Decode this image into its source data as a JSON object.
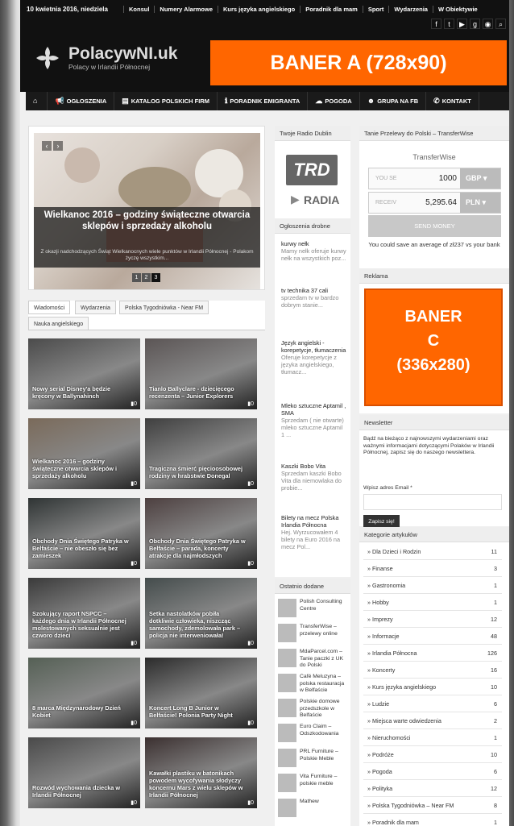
{
  "top": {
    "date": "10 kwietnia 2016, niedziela",
    "links": [
      "Konsul",
      "Numery Alarmowe",
      "Kurs języka angielskiego",
      "Poradnik dla mam",
      "Sport",
      "Wydarzenia",
      "W Obiektywie"
    ],
    "social": [
      "f",
      "t",
      "yt",
      "g+",
      "rss",
      "search"
    ]
  },
  "header": {
    "logo_title": "PolacywNI.uk",
    "logo_sub": "Polacy w Irlandii Północnej",
    "banner_a": "BANER A (728x90)"
  },
  "nav": {
    "items": [
      {
        "icon": "home",
        "label": ""
      },
      {
        "icon": "megaphone",
        "label": "OGŁOSZENIA"
      },
      {
        "icon": "book",
        "label": "KATALOG POLSKICH FIRM"
      },
      {
        "icon": "info",
        "label": "PORADNIK EMIGRANTA"
      },
      {
        "icon": "cloud",
        "label": "POGODA"
      },
      {
        "icon": "group",
        "label": "GRUPA NA FB"
      },
      {
        "icon": "phone",
        "label": "KONTAKT"
      }
    ]
  },
  "slider": {
    "title": "Wielkanoc 2016 – godziny świąteczne otwarcia sklepów i sprzedaży alkoholu",
    "desc": "Z okazji nadchodzących Świąt Wielkanocnych wiele punktów w Irlandii Północnej - Polakom życzę wszystkim...",
    "pages": [
      "1",
      "2",
      "3"
    ],
    "active": "3"
  },
  "tabs": [
    "Wiadomości",
    "Wydarzenia",
    "Polska Tygodniówka - Near FM",
    "Nauka angielskiego"
  ],
  "cards": [
    {
      "title": "Nowy serial Disney'a będzie kręcony w Ballynahinch",
      "count": "0"
    },
    {
      "title": "Tianlo Ballyclare - dziecięcego recenzenta – Junior Explorers",
      "count": "0"
    },
    {
      "title": "Wielkanoc 2016 – godziny świąteczne otwarcia sklepów i sprzedaży alkoholu",
      "count": "0"
    },
    {
      "title": "Tragiczna śmierć pięcioosobowej rodziny w hrabstwie Donegal",
      "count": "0"
    },
    {
      "title": "Obchody Dnia Świętego Patryka w Belfaście – nie obeszło się bez zamieszek",
      "count": "0"
    },
    {
      "title": "Obchody Dnia Świętego Patryka w Belfaście – parada, koncerty atrakcje dla najmłodszych",
      "count": "0"
    },
    {
      "title": "Szokujący raport NSPCC – każdego dnia w Irlandii Północnej molestowanych seksualnie jest czworo dzieci",
      "count": "0"
    },
    {
      "title": "Setka nastolatków pobiła dotkliwie człowieka, niszcząc samochody, zdemolowała park – policja nie interweniowała!",
      "count": "0"
    },
    {
      "title": "8 marca Międzynarodowy Dzień Kobiet",
      "count": "0"
    },
    {
      "title": "Koncert Long B Junior w Belfaście! Polonia Party Night",
      "count": "0"
    },
    {
      "title": "Rozwód wychowania dziecka w Irlandii Północnej",
      "count": "0"
    },
    {
      "title": "Kawałki plastiku w batonikach powodem wycofywania słodyczy koncernu Mars z wielu sklepów w Irlandii Północnej",
      "count": "0"
    }
  ],
  "radio": {
    "header": "Twoje Radio Dublin",
    "logo": "TRD",
    "caption": "RADIA"
  },
  "ads": {
    "header": "Ogłoszenia drobne",
    "items": [
      {
        "t": "kurwy nełk",
        "d": "Mamy nełk oferuje kurwy nełk na wszystkich poz..."
      },
      {
        "t": "tv technika 37 cali",
        "d": "sprzedam tv w bardzo dobrym stanie..."
      },
      {
        "t": "Język angielski - korepetycje, tłumaczenia",
        "d": "Oferuje korepetycje z języka angielskiego, tłumacz..."
      },
      {
        "t": "Mleko sztuczne Aptamil , SMA",
        "d": "Sprzedam ( nie otwarte) mleko sztuczne Aptamil 1 ..."
      },
      {
        "t": "Kaszki Bobo Vita",
        "d": "Sprzedam kaszki Bobo Vita dla niemowlaka do probie..."
      },
      {
        "t": "Bilety na mecz Polska Irlandia Północna",
        "d": "Hej. Wyrzucowałem 4 bilety na Euro 2016 na mecz Pol..."
      }
    ]
  },
  "latest": {
    "header": "Ostatnio dodane",
    "items": [
      "Polish Consulting Centre",
      "TransferWise – przelewy online",
      "MdaParcel.com – Tanie paczki z UK do Polski",
      "Café Meluzyna – polska restauracja w Belfaście",
      "Polskie domowe przedszkole w Belfaście",
      "Euro Claim – Odszkodowania",
      "PRL Furniture – Polskie Meble",
      "Vita Furniture – polskie meble",
      "Mathew"
    ]
  },
  "transferwise": {
    "header": "Tanie Przelewy do Polski – TransferWise",
    "logo": "TransferWise",
    "you_send_label": "YOU SE",
    "you_send_value": "1000",
    "you_send_cur": "GBP",
    "receive_label": "RECEIV",
    "receive_value": "5,295.64",
    "receive_cur": "PLN",
    "button": "SEND MONEY",
    "note": "You could save an average of zł237 vs your bank"
  },
  "reklama": {
    "header": "Reklama",
    "banner_c_1": "BANER",
    "banner_c_2": "C",
    "banner_c_3": "(336x280)"
  },
  "newsletter": {
    "header": "Newsletter",
    "text": "Bądź na bieżąco z najnowszymi wydarzeniami oraz ważnymi informacjami dotyczącymi Polaków w Irlandii Północnej, zapisz się do naszego newslettera.",
    "label": "Wpisz adres Email *",
    "button": "Zapisz się!"
  },
  "categories": {
    "header": "Kategorie artykułów",
    "items": [
      {
        "n": "Dla Dzieci i Rodzin",
        "c": "11"
      },
      {
        "n": "Finanse",
        "c": "3"
      },
      {
        "n": "Gastronomia",
        "c": "1"
      },
      {
        "n": "Hobby",
        "c": "1"
      },
      {
        "n": "Imprezy",
        "c": "12"
      },
      {
        "n": "Informacje",
        "c": "48"
      },
      {
        "n": "Irlandia Północna",
        "c": "126"
      },
      {
        "n": "Koncerty",
        "c": "16"
      },
      {
        "n": "Kurs języka angielskiego",
        "c": "10"
      },
      {
        "n": "Ludzie",
        "c": "6"
      },
      {
        "n": "Miejsca warte odwiedzenia",
        "c": "2"
      },
      {
        "n": "Nieruchomości",
        "c": "1"
      },
      {
        "n": "Podróże",
        "c": "10"
      },
      {
        "n": "Pogoda",
        "c": "6"
      },
      {
        "n": "Polityka",
        "c": "12"
      },
      {
        "n": "Polska Tygodniówka – Near FM",
        "c": "8"
      },
      {
        "n": "Poradnik dla mam",
        "c": "1"
      }
    ]
  }
}
